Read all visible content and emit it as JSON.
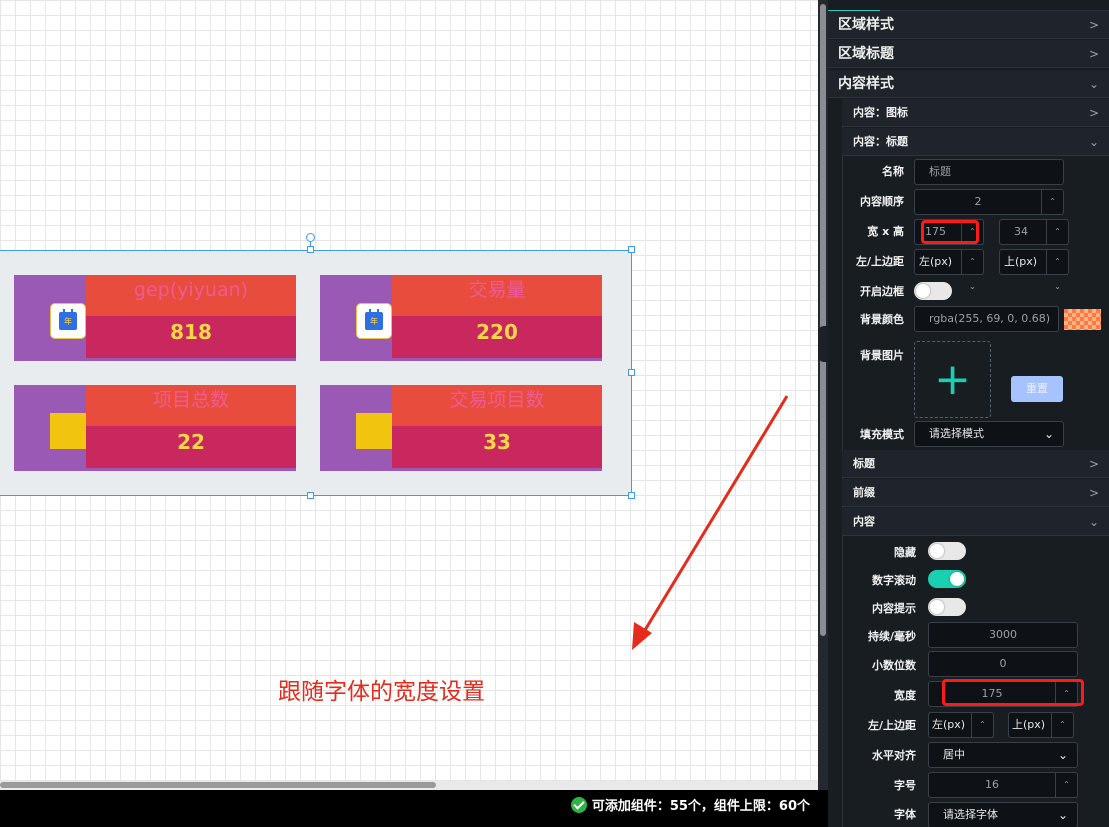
{
  "canvas": {
    "cards": [
      {
        "title": "gep(yiyuan)",
        "value": "818",
        "icon": "calendar-icon",
        "icon_text": "年"
      },
      {
        "title": "交易量",
        "value": "220",
        "icon": "calendar-icon",
        "icon_text": "年"
      },
      {
        "title": "项目总数",
        "value": "22",
        "icon": "yellow-square-icon"
      },
      {
        "title": "交易项目数",
        "value": "33",
        "icon": "yellow-square-icon"
      }
    ],
    "annotation": "跟随字体的宽度设置"
  },
  "status": {
    "text": "可添加组件：55个，组件上限：60个"
  },
  "panel": {
    "sections": {
      "area_style": "区域样式",
      "area_title": "区域标题",
      "content_style": "内容样式"
    },
    "subsections": {
      "content_icon": "内容：图标",
      "content_title": "内容：标题",
      "title": "标题",
      "prefix": "前缀",
      "content": "内容"
    },
    "title_form": {
      "name_label": "名称",
      "name_placeholder": "标题",
      "order_label": "内容顺序",
      "order_value": "2",
      "size_label": "宽 x 高",
      "width_value": "175",
      "height_value": "34",
      "margin_label": "左/上边距",
      "left_placeholder": "左(px)",
      "top_placeholder": "上(px)",
      "border_label": "开启边框",
      "bg_color_label": "背景颜色",
      "bg_color_value": "rgba(255, 69, 0, 0.68)",
      "bg_image_label": "背景图片",
      "reset_label": "重置",
      "fill_label": "填充模式",
      "fill_placeholder": "请选择模式"
    },
    "content_form": {
      "hide_label": "隐藏",
      "scroll_label": "数字滚动",
      "tip_label": "内容提示",
      "duration_label": "持续/毫秒",
      "duration_value": "3000",
      "decimals_label": "小数位数",
      "decimals_value": "0",
      "width_label": "宽度",
      "width_value": "175",
      "margin_label": "左/上边距",
      "left_placeholder": "左(px)",
      "top_placeholder": "上(px)",
      "align_label": "水平对齐",
      "align_value": "居中",
      "fontsize_label": "字号",
      "fontsize_value": "16",
      "font_label": "字体",
      "font_placeholder": "请选择字体"
    },
    "toggles": {
      "border_on": false,
      "hide_on": false,
      "scroll_on": true,
      "tip_on": false
    },
    "colors": {
      "accent": "#19d0b0",
      "annot_red": "#e62a1c",
      "highlight": "#ff1a1a"
    }
  }
}
